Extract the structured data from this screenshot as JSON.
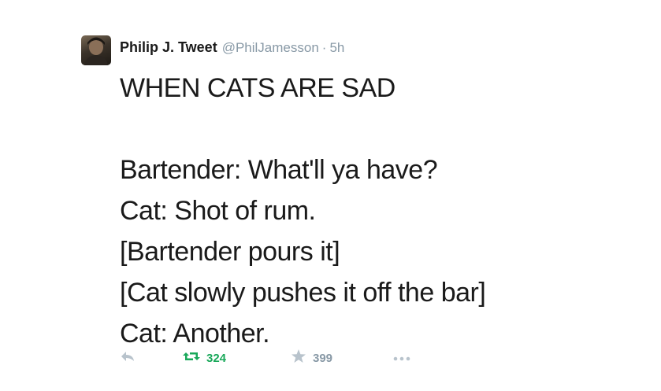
{
  "tweet": {
    "author_name": "Philip J. Tweet",
    "handle": "@PhilJamesson",
    "separator": "·",
    "time": "5h",
    "lines": [
      "WHEN CATS ARE SAD",
      "",
      "Bartender: What'll ya have?",
      "Cat: Shot of rum.",
      "[Bartender pours it]",
      "[Cat slowly pushes it off the bar]",
      "Cat: Another."
    ],
    "retweet_count": "324",
    "favorite_count": "399"
  },
  "icons": {
    "reply": "reply-icon",
    "retweet": "retweet-icon",
    "favorite": "star-icon",
    "more": "more-icon"
  },
  "colors": {
    "text": "#1a1a1a",
    "muted": "#8899a6",
    "retweet_green": "#19a85a",
    "icon_gray": "#b8c3cc"
  }
}
